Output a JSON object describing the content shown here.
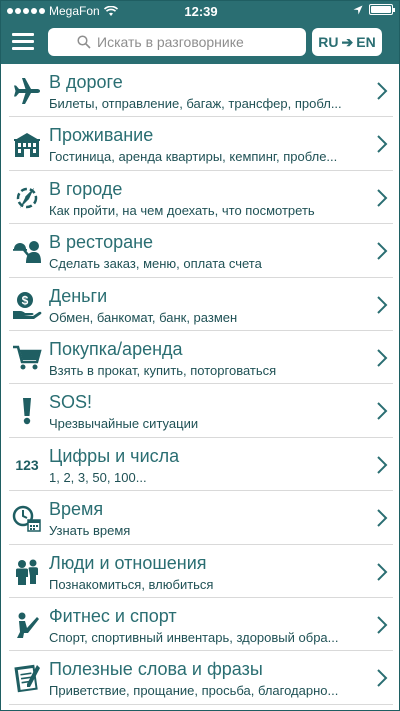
{
  "status": {
    "carrier": "MegaFon",
    "time": "12:39"
  },
  "header": {
    "search_placeholder": "Искать в разговорнике",
    "lang_from": "RU",
    "lang_arrow": "➔",
    "lang_to": "EN"
  },
  "categories": [
    {
      "title": "В дороге",
      "subtitle": "Билеты, отправление, багаж, трансфер, пробл...",
      "icon": "airplane-icon"
    },
    {
      "title": "Проживание",
      "subtitle": "Гостиница, аренда квартиры, кемпинг, пробле...",
      "icon": "hotel-icon"
    },
    {
      "title": "В городе",
      "subtitle": "Как пройти, на чем доехать, что посмотреть",
      "icon": "compass-icon"
    },
    {
      "title": "В ресторане",
      "subtitle": "Сделать заказ, меню, оплата счета",
      "icon": "waiter-icon"
    },
    {
      "title": "Деньги",
      "subtitle": "Обмен, банкомат, банк, размен",
      "icon": "money-hand-icon"
    },
    {
      "title": "Покупка/аренда",
      "subtitle": "Взять в прокат, купить, поторговаться",
      "icon": "cart-icon"
    },
    {
      "title": "SOS!",
      "subtitle": "Чрезвычайные ситуации",
      "icon": "exclamation-icon"
    },
    {
      "title": "Цифры и числа",
      "subtitle": "1, 2, 3, 50, 100...",
      "icon": "numbers-icon",
      "icon_text": "123"
    },
    {
      "title": "Время",
      "subtitle": "Узнать время",
      "icon": "clock-calendar-icon"
    },
    {
      "title": "Люди и отношения",
      "subtitle": "Познакомиться, влюбиться",
      "icon": "people-icon"
    },
    {
      "title": "Фитнес и спорт",
      "subtitle": "Спорт, спортивный инвентарь, здоровый обра...",
      "icon": "stretching-icon"
    },
    {
      "title": "Полезные слова и фразы",
      "subtitle": "Приветствие, прощание, просьба, благодарно...",
      "icon": "notepad-icon"
    }
  ],
  "colors": {
    "primary": "#2a6e72",
    "icon": "#1f5e62",
    "divider": "#d9d9d9"
  }
}
